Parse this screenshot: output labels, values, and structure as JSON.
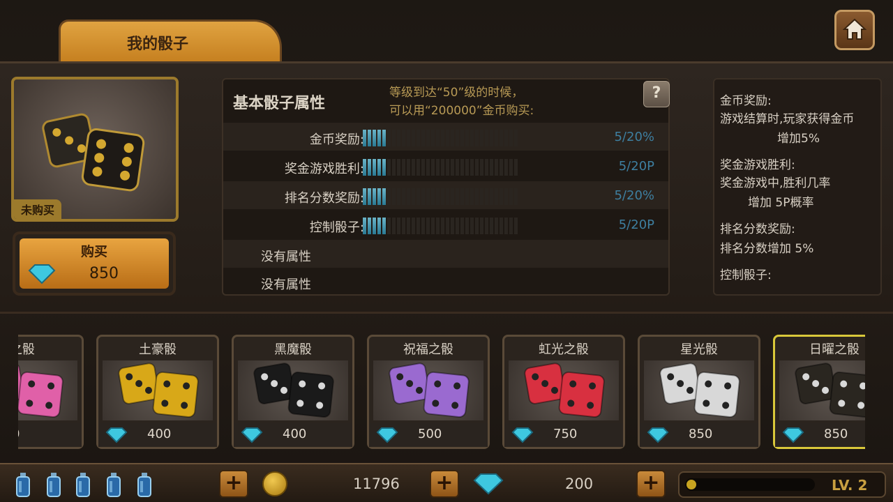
{
  "header": {
    "tab_label": "我的骰子"
  },
  "preview": {
    "status_tag": "未购买"
  },
  "buy": {
    "label": "购买",
    "price": "850"
  },
  "attributes": {
    "title": "基本骰子属性",
    "note_line1": "等级到达“50”级的时候，",
    "note_line2": "可以用“200000”金币购买:",
    "help": "?",
    "rows": [
      {
        "name": "金币奖励:",
        "value": "5/20%",
        "level": 5,
        "max": 20
      },
      {
        "name": "奖金游戏胜利:",
        "value": "5/20P",
        "level": 5,
        "max": 20
      },
      {
        "name": "排名分数奖励:",
        "value": "5/20%",
        "level": 5,
        "max": 20
      },
      {
        "name": "控制骰子:",
        "value": "5/20P",
        "level": 5,
        "max": 20
      }
    ],
    "none1": "没有属性",
    "none2": "没有属性"
  },
  "description": {
    "l1": "金币奖励:",
    "l2": "游戏结算时,玩家获得金币",
    "l3": "增加5%",
    "l4": "奖金游戏胜利:",
    "l5": "奖金游戏中,胜利几率",
    "l6": "增加 5P概率",
    "l7": "排名分数奖励:",
    "l8": "排名分数增加 5%",
    "l9": "控制骰子:"
  },
  "dice": [
    {
      "name": "之骰",
      "price": "0",
      "color": "#e060a8"
    },
    {
      "name": "土豪骰",
      "price": "400",
      "color": "#d8a818"
    },
    {
      "name": "黑魔骰",
      "price": "400",
      "color": "#1a1a1a"
    },
    {
      "name": "祝福之骰",
      "price": "500",
      "color": "#9a6ad0"
    },
    {
      "name": "虹光之骰",
      "price": "750",
      "color": "#d83040"
    },
    {
      "name": "星光骰",
      "price": "850",
      "color": "#d8d8d8"
    },
    {
      "name": "日曜之骰",
      "price": "850",
      "color": "#2a2620"
    }
  ],
  "bottom": {
    "coins": "11796",
    "gems": "200",
    "level": "LV.  2"
  },
  "colors": {
    "accent": "#e0a341",
    "gem": "#3ec8e0",
    "bar": "#2a7a94"
  }
}
